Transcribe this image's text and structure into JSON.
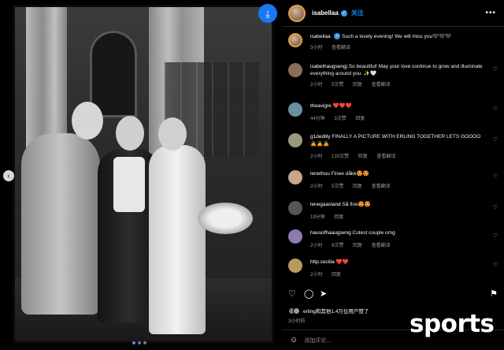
{
  "post": {
    "author": "isabellaa",
    "follow_label": "关注",
    "more_icon": "more-horizontal-icon",
    "save_icon": "download-icon",
    "carousel_dots": 3,
    "carousel_active": 1
  },
  "caption": {
    "author": "isabellaa",
    "text": "Such a lovely evening! We will miss you🖤🖤🖤",
    "time": "3小时",
    "translate": "查看翻译"
  },
  "comments": [
    {
      "user": "isabelhaugsengj",
      "text": "So beautiful! May your love continue to grow and illuminate everything around you. ✨🤍",
      "time": "2小时",
      "likes": "5次赞",
      "reply": "回复",
      "translate": "查看翻译"
    },
    {
      "user": "theavigre",
      "text": "❤️❤️❤️",
      "time": "44分钟",
      "likes": "3次赞",
      "reply": "回复",
      "translate": ""
    },
    {
      "user": "g1dedlily",
      "text": "FINALLY A PICTURE WITH ERLING TOGETHER LETS GOOOO 🙇🙇🙇",
      "time": "2小时",
      "likes": "130次赞",
      "reply": "回复",
      "translate": "查看翻译"
    },
    {
      "user": "lenethuu",
      "text": "Finee dåkk😍😍",
      "time": "2小时",
      "likes": "5次赞",
      "reply": "回复",
      "translate": "查看翻译"
    },
    {
      "user": "lenegaasland",
      "text": "Så fine😍😍",
      "time": "19分钟",
      "likes": "",
      "reply": "回复",
      "translate": ""
    },
    {
      "user": "hausofhaaugseng",
      "text": "Cutest couple omg",
      "time": "2小时",
      "likes": "6次赞",
      "reply": "回复",
      "translate": "查看翻译"
    },
    {
      "user": "http.cecilia",
      "text": "❤️❤️",
      "time": "2小时",
      "likes": "",
      "reply": "回复",
      "translate": ""
    }
  ],
  "likes_line": "erling和其他1.4万位用户赞了",
  "post_time": "3小时前",
  "add_comment_placeholder": "添加评论...",
  "watermark": "sports",
  "colors": {
    "accent": "#0095f6",
    "verified": "#3897f0",
    "heart": "#ed4956",
    "background": "#000000"
  }
}
